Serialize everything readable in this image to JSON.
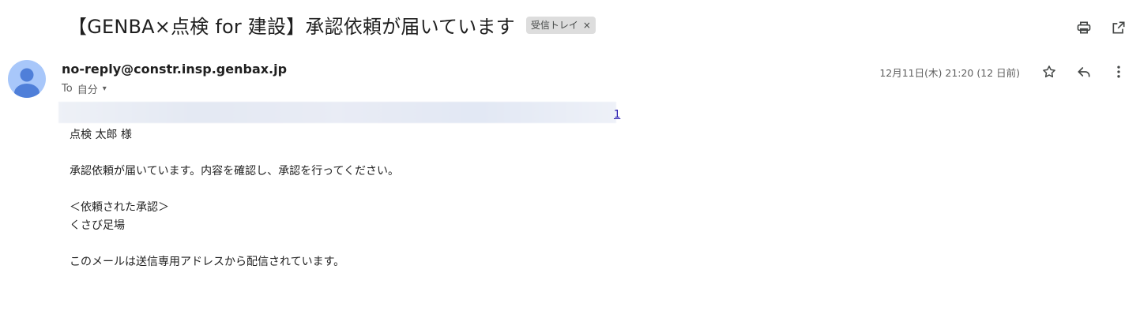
{
  "subject": {
    "title": "【GENBA×点検 for 建設】承認依頼が届いています",
    "label": "受信トレイ",
    "label_close": "×"
  },
  "toolbar": {
    "print_icon": "print-icon",
    "open_new_window_icon": "open-in-new-icon"
  },
  "sender": {
    "email": "no-reply@constr.insp.genbax.jp",
    "to_prefix": "To",
    "to_value": "自分",
    "to_caret": "▾",
    "timestamp": "12月11日(木) 21:20 (12 日前)"
  },
  "actions": {
    "star_icon": "star-icon",
    "reply_icon": "reply-icon",
    "more_icon": "more-vert-icon"
  },
  "body": {
    "banner_link": "1",
    "greeting": "点検 太郎  様",
    "line1": "承認依頼が届いています。内容を確認し、承認を行ってください。",
    "section_header": "＜依頼された承認＞",
    "item": "くさび足場",
    "footer": "このメールは送信専用アドレスから配信されています。"
  }
}
